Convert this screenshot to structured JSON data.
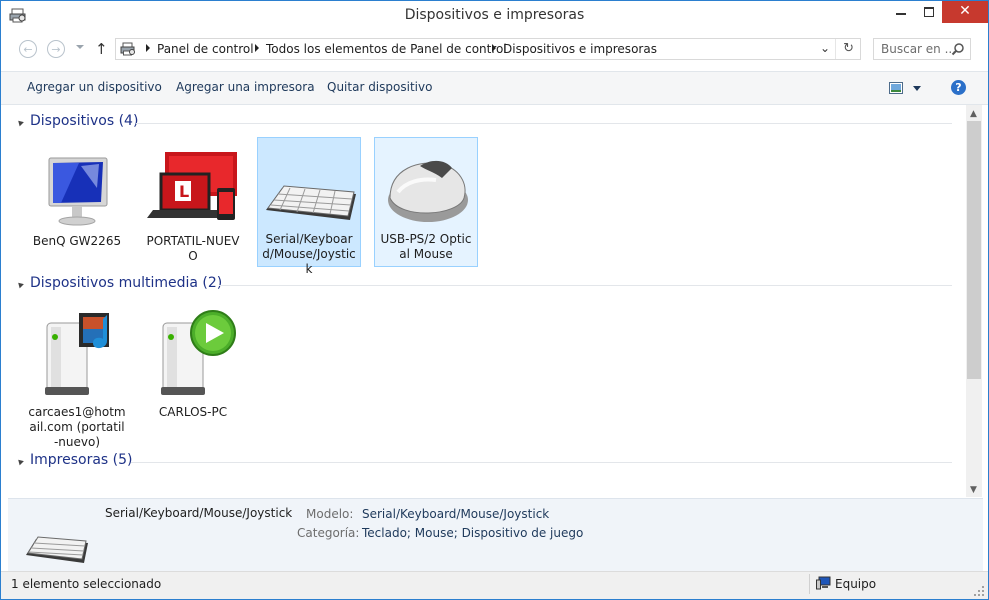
{
  "window": {
    "title": "Dispositivos e impresoras",
    "close_symbol": "✕"
  },
  "nav": {
    "back_symbol": "←",
    "forward_symbol": "→",
    "up_symbol": "↑",
    "breadcrumbs": [
      "Panel de control",
      "Todos los elementos de Panel de control",
      "Dispositivos e impresoras"
    ],
    "dropdown_symbol": "⌄",
    "refresh_symbol": "↻",
    "search_placeholder": "Buscar en ..."
  },
  "commands": {
    "add_device": "Agregar un dispositivo",
    "add_printer": "Agregar una impresora",
    "remove_device": "Quitar dispositivo",
    "help_symbol": "?"
  },
  "groups": {
    "devices": {
      "title": "Dispositivos (4)",
      "items": [
        {
          "label": "BenQ GW2265",
          "icon": "monitor-icon"
        },
        {
          "label": "PORTATIL-NUEVO",
          "icon": "computer-laptop-icon"
        },
        {
          "label": "Serial/Keyboard/Mouse/Joystick",
          "icon": "keyboard-icon"
        },
        {
          "label": "USB-PS/2 Optical Mouse",
          "icon": "mouse-icon"
        }
      ]
    },
    "multimedia": {
      "title": "Dispositivos multimedia (2)",
      "items": [
        {
          "label": "carcaes1@hotmail.com (portatil-nuevo)",
          "icon": "media-server-icon"
        },
        {
          "label": "CARLOS-PC",
          "icon": "media-player-icon"
        }
      ]
    },
    "printers": {
      "title": "Impresoras (5)"
    }
  },
  "details": {
    "name": "Serial/Keyboard/Mouse/Joystick",
    "model_label": "Modelo:",
    "model_value": "Serial/Keyboard/Mouse/Joystick",
    "category_label": "Categoría:",
    "category_value": "Teclado; Mouse; Dispositivo de juego"
  },
  "status": {
    "left": "1 elemento seleccionado",
    "right": "Equipo"
  },
  "colors": {
    "accent": "#2b7fcf",
    "selection": "#cce8ff",
    "group_title": "#1e3287",
    "close_button": "#c7392e"
  }
}
